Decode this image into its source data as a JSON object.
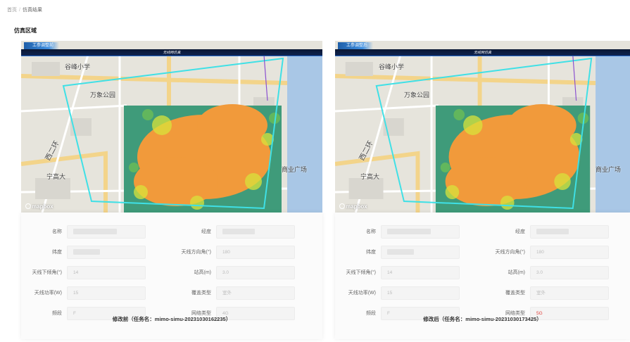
{
  "breadcrumb": {
    "home": "首页",
    "separator": "/",
    "current": "仿真结果"
  },
  "section_title": "仿真区域",
  "colors": {
    "coverage_orange": "#f19a3b",
    "coverage_green": "#3f9b7a",
    "boundary": "#3fe0e6",
    "accent_red": "#e0403a"
  },
  "panels": [
    {
      "map": {
        "tag": "工参调整前",
        "banner": "无线网仿真",
        "labels": {
          "school": "谷峰小学",
          "park": "万象公园",
          "road": "西二环",
          "plaza": "商业广场",
          "fire": "宁高大"
        },
        "logo": "mapbox"
      },
      "fields": {
        "name_label": "名称",
        "name_value": "",
        "lon_label": "经度",
        "lon_value": "",
        "lat_label": "纬度",
        "lat_value": "",
        "azimuth_label": "天线方向角(°)",
        "azimuth_value": "180",
        "tilt_label": "天线下倾角(°)",
        "tilt_value": "14",
        "height_label": "站高(m)",
        "height_value": "3.0",
        "power_label": "天线功率(W)",
        "power_value": "15",
        "cover_label": "覆盖类型",
        "cover_value": "室外",
        "band_label": "频段",
        "band_value": "F",
        "net_label": "网络类型",
        "net_value": "4G"
      },
      "caption": "修改前（任务名：mimo-simu-20231030162235）"
    },
    {
      "map": {
        "tag": "工参调整后",
        "banner": "无线网仿真",
        "labels": {
          "school": "谷峰小学",
          "park": "万象公园",
          "road": "西二环",
          "plaza": "商业广场",
          "fire": "宁高大"
        },
        "logo": "mapbox"
      },
      "fields": {
        "name_label": "名称",
        "name_value": "",
        "lon_label": "经度",
        "lon_value": "",
        "lat_label": "纬度",
        "lat_value": "",
        "azimuth_label": "天线方向角(°)",
        "azimuth_value": "180",
        "tilt_label": "天线下倾角(°)",
        "tilt_value": "14",
        "height_label": "站高(m)",
        "height_value": "3.0",
        "power_label": "天线功率(W)",
        "power_value": "15",
        "cover_label": "覆盖类型",
        "cover_value": "室外",
        "band_label": "频段",
        "band_value": "F",
        "net_label": "网络类型",
        "net_value": "5G"
      },
      "caption": "修改后（任务名：mimo-simu-20231030173425）"
    }
  ]
}
